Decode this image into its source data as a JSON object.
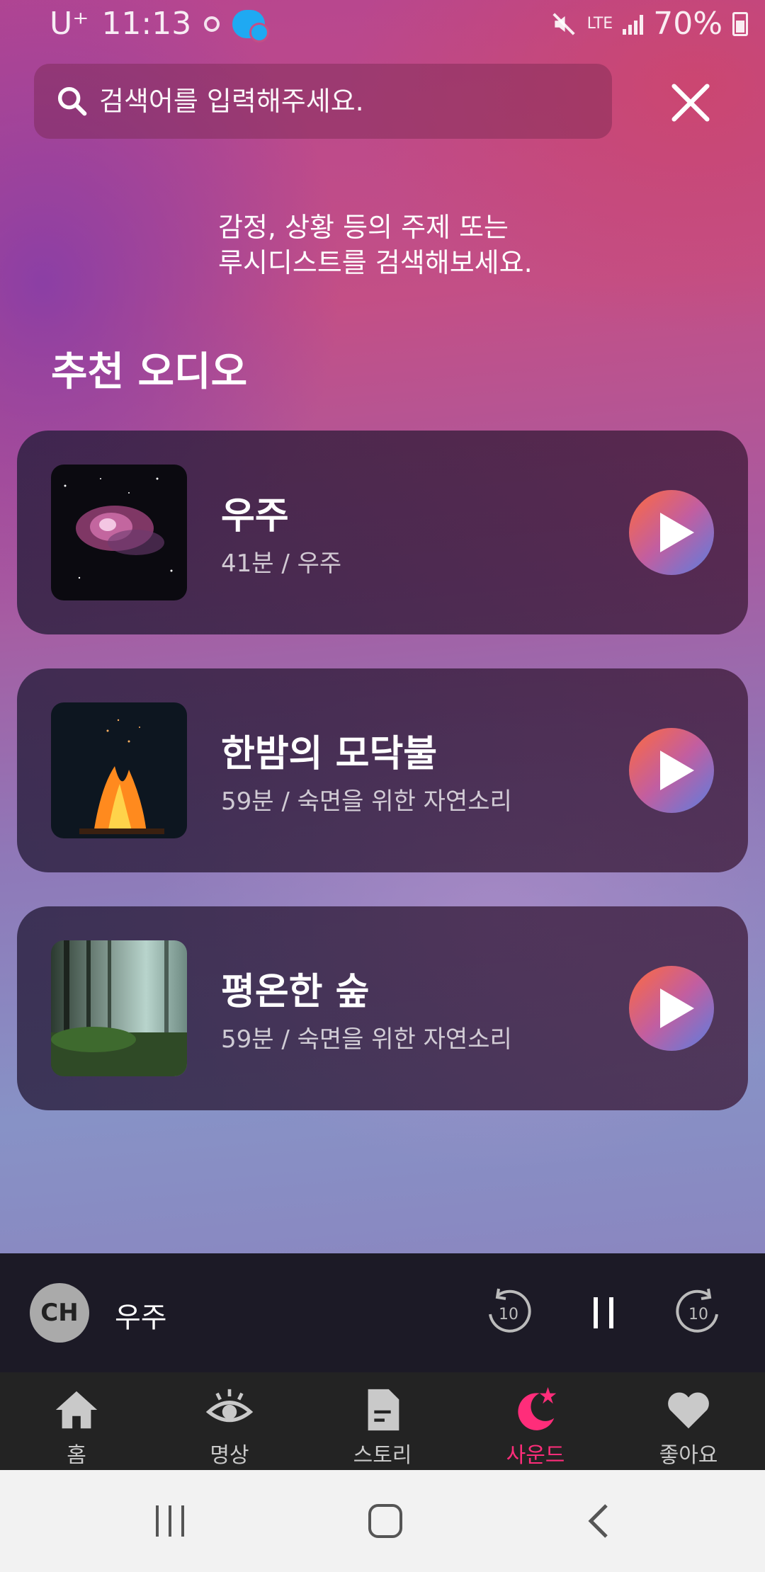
{
  "status_bar": {
    "carrier": "U⁺",
    "time": "11:13",
    "network": "LTE",
    "battery": "70%"
  },
  "search": {
    "placeholder": "검색어를 입력해주세요."
  },
  "hint": {
    "line1": "감정, 상황 등의 주제 또는",
    "line2": "루시디스트를 검색해보세요."
  },
  "section_title": "추천 오디오",
  "cards": [
    {
      "title": "우주",
      "subtitle": "41분 / 우주",
      "thumbnail": "nebula-image"
    },
    {
      "title": "한밤의 모닥불",
      "subtitle": "59분 / 숙면을 위한 자연소리",
      "thumbnail": "campfire-image"
    },
    {
      "title": "평온한 숲",
      "subtitle": "59분 / 숙면을 위한 자연소리",
      "thumbnail": "forest-image"
    }
  ],
  "player": {
    "avatar_text": "CH",
    "title": "우주",
    "rewind_label": "10",
    "forward_label": "10"
  },
  "nav": {
    "items": [
      {
        "label": "홈",
        "icon": "home-icon"
      },
      {
        "label": "명상",
        "icon": "eye-icon"
      },
      {
        "label": "스토리",
        "icon": "document-icon"
      },
      {
        "label": "사운드",
        "icon": "moon-star-icon",
        "active": true
      },
      {
        "label": "좋아요",
        "icon": "heart-icon"
      }
    ]
  },
  "colors": {
    "accent": "#ff2d7a",
    "player_bg": "#1c1a26",
    "nav_bg": "#232323"
  }
}
